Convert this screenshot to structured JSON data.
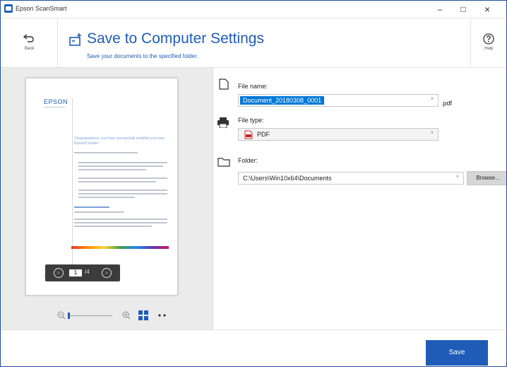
{
  "window": {
    "title": "Epson ScanSmart",
    "minimize": "–",
    "maximize": "□",
    "close": "×"
  },
  "header": {
    "back_label": "Back",
    "title": "Save to Computer Settings",
    "subtitle": "Save your documents to the specified folder.",
    "help_label": "Help"
  },
  "preview": {
    "logo": "EPSON",
    "headline": "Congratulations, you have successfully installed your new Epson® printer!",
    "page_current": "1",
    "page_total": "/4"
  },
  "form": {
    "file_name_label": "File name:",
    "file_name_value": "Document_20180308_0001",
    "file_ext": ".pdf",
    "file_type_label": "File type:",
    "file_type_value": "PDF",
    "folder_label": "Folder:",
    "folder_value": "C:\\Users\\Win10x64\\Documents",
    "browse_label": "Browse..."
  },
  "footer": {
    "save_label": "Save"
  },
  "colors": {
    "accent": "#1f5cb8",
    "panel_bg": "#ebebeb",
    "highlight": "#0078d7"
  },
  "icons": [
    "back-arrow-icon",
    "add-to-computer-icon",
    "help-icon",
    "zoom-out-icon",
    "zoom-in-icon",
    "thumbnails-icon",
    "more-icon",
    "prev-page-icon",
    "next-page-icon",
    "file-icon",
    "printer-icon",
    "pdf-icon",
    "folder-icon",
    "chevron-down-icon"
  ]
}
